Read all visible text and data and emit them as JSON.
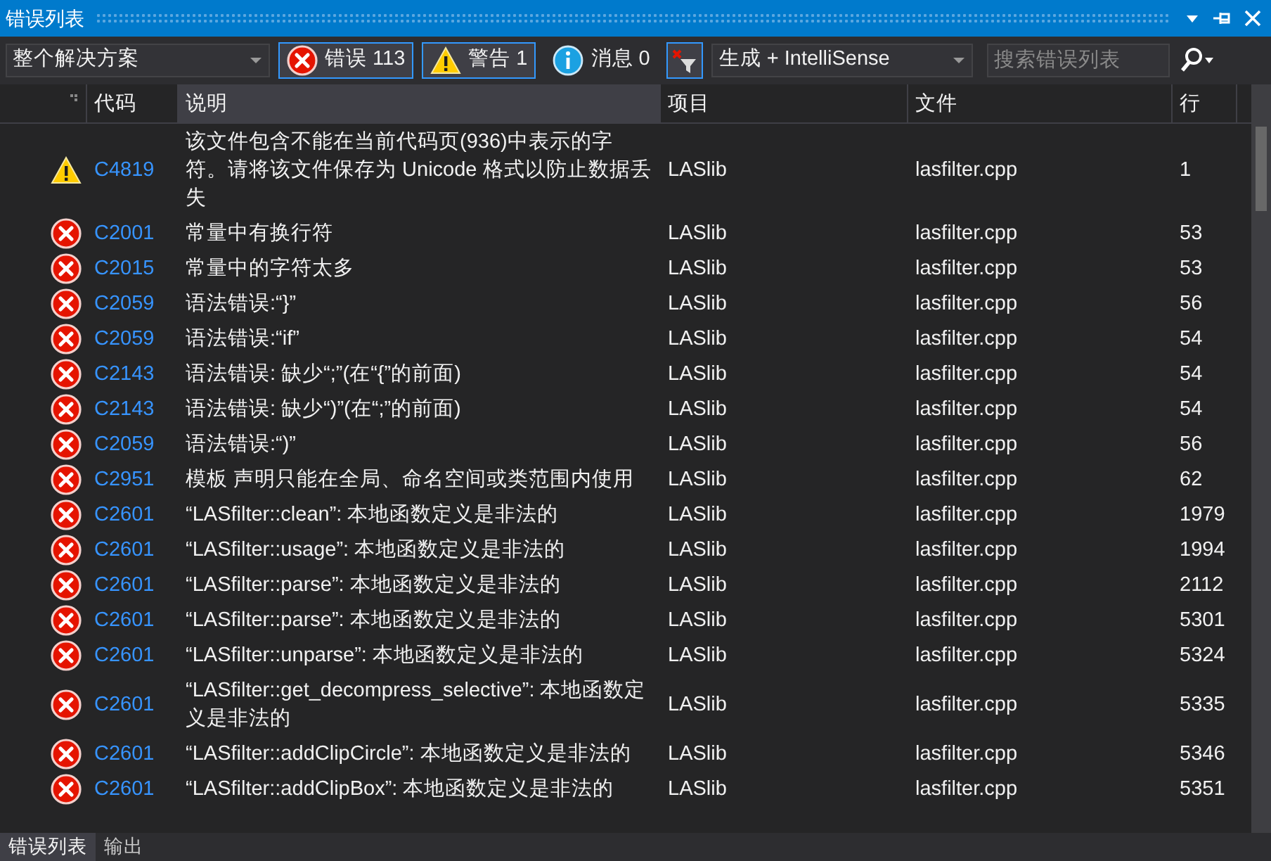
{
  "window": {
    "title": "错误列表"
  },
  "toolbar": {
    "scope": "整个解决方案",
    "filters": [
      {
        "kind": "error",
        "label": "错误 113",
        "selected": true
      },
      {
        "kind": "warning",
        "label": "警告 1",
        "selected": true
      },
      {
        "kind": "info",
        "label": "消息 0",
        "selected": false
      }
    ],
    "clear_filter_selected": true,
    "source": "生成 + IntelliSense",
    "search": {
      "placeholder": "搜索错误列表"
    }
  },
  "table": {
    "columns": [
      {
        "label": "代码",
        "selected": false
      },
      {
        "label": "说明",
        "selected": true
      },
      {
        "label": "项目",
        "selected": false
      },
      {
        "label": "文件",
        "selected": false
      },
      {
        "label": "行",
        "selected": false
      }
    ],
    "rows": [
      {
        "kind": "warning",
        "code": "C4819",
        "description": "该文件包含不能在当前代码页(936)中表示的字符。请将该文件保存为 Unicode 格式以防止数据丢失",
        "project": "LASlib",
        "file": "lasfilter.cpp",
        "line": "1"
      },
      {
        "kind": "error",
        "code": "C2001",
        "description": "常量中有换行符",
        "project": "LASlib",
        "file": "lasfilter.cpp",
        "line": "53"
      },
      {
        "kind": "error",
        "code": "C2015",
        "description": "常量中的字符太多",
        "project": "LASlib",
        "file": "lasfilter.cpp",
        "line": "53"
      },
      {
        "kind": "error",
        "code": "C2059",
        "description": "语法错误:“}”",
        "project": "LASlib",
        "file": "lasfilter.cpp",
        "line": "56"
      },
      {
        "kind": "error",
        "code": "C2059",
        "description": "语法错误:“if”",
        "project": "LASlib",
        "file": "lasfilter.cpp",
        "line": "54"
      },
      {
        "kind": "error",
        "code": "C2143",
        "description": "语法错误: 缺少“;”(在“{”的前面)",
        "project": "LASlib",
        "file": "lasfilter.cpp",
        "line": "54"
      },
      {
        "kind": "error",
        "code": "C2143",
        "description": "语法错误: 缺少“)”(在“;”的前面)",
        "project": "LASlib",
        "file": "lasfilter.cpp",
        "line": "54"
      },
      {
        "kind": "error",
        "code": "C2059",
        "description": "语法错误:“)”",
        "project": "LASlib",
        "file": "lasfilter.cpp",
        "line": "56"
      },
      {
        "kind": "error",
        "code": "C2951",
        "description": "模板 声明只能在全局、命名空间或类范围内使用",
        "project": "LASlib",
        "file": "lasfilter.cpp",
        "line": "62"
      },
      {
        "kind": "error",
        "code": "C2601",
        "description": "“LASfilter::clean”: 本地函数定义是非法的",
        "project": "LASlib",
        "file": "lasfilter.cpp",
        "line": "1979"
      },
      {
        "kind": "error",
        "code": "C2601",
        "description": "“LASfilter::usage”: 本地函数定义是非法的",
        "project": "LASlib",
        "file": "lasfilter.cpp",
        "line": "1994"
      },
      {
        "kind": "error",
        "code": "C2601",
        "description": "“LASfilter::parse”: 本地函数定义是非法的",
        "project": "LASlib",
        "file": "lasfilter.cpp",
        "line": "2112"
      },
      {
        "kind": "error",
        "code": "C2601",
        "description": "“LASfilter::parse”: 本地函数定义是非法的",
        "project": "LASlib",
        "file": "lasfilter.cpp",
        "line": "5301"
      },
      {
        "kind": "error",
        "code": "C2601",
        "description": "“LASfilter::unparse”: 本地函数定义是非法的",
        "project": "LASlib",
        "file": "lasfilter.cpp",
        "line": "5324"
      },
      {
        "kind": "error",
        "code": "C2601",
        "description": "“LASfilter::get_decompress_selective”: 本地函数定义是非法的",
        "project": "LASlib",
        "file": "lasfilter.cpp",
        "line": "5335"
      },
      {
        "kind": "error",
        "code": "C2601",
        "description": "“LASfilter::addClipCircle”: 本地函数定义是非法的",
        "project": "LASlib",
        "file": "lasfilter.cpp",
        "line": "5346"
      },
      {
        "kind": "error",
        "code": "C2601",
        "description": "“LASfilter::addClipBox”: 本地函数定义是非法的",
        "project": "LASlib",
        "file": "lasfilter.cpp",
        "line": "5351"
      }
    ]
  },
  "bottom_tabs": [
    {
      "label": "错误列表",
      "selected": true
    },
    {
      "label": "输出",
      "selected": false
    }
  ]
}
